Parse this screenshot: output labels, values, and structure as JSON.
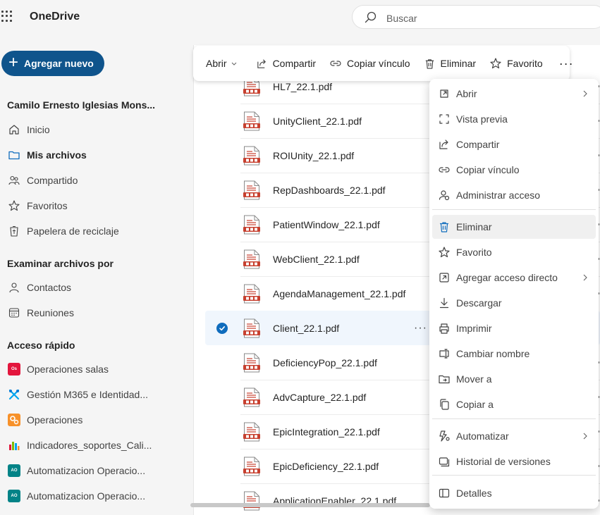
{
  "app": {
    "name": "OneDrive"
  },
  "search": {
    "placeholder": "Buscar"
  },
  "sidebar": {
    "add_new": "Agregar nuevo",
    "user": "Camilo Ernesto Iglesias Mons...",
    "nav": [
      {
        "label": "Inicio",
        "icon": "home-icon"
      },
      {
        "label": "Mis archivos",
        "icon": "folder-icon",
        "active": true
      },
      {
        "label": "Compartido",
        "icon": "people-icon"
      },
      {
        "label": "Favoritos",
        "icon": "star-icon"
      },
      {
        "label": "Papelera de reciclaje",
        "icon": "recycle-bin-icon"
      }
    ],
    "browse_title": "Examinar archivos por",
    "browse": [
      {
        "label": "Contactos",
        "icon": "person-icon"
      },
      {
        "label": "Reuniones",
        "icon": "calendar-icon"
      }
    ],
    "quick_title": "Acceso rápido",
    "quick": [
      {
        "label": "Operaciones salas",
        "badge": "Os",
        "color": "#e3163d"
      },
      {
        "label": "Gestión M365 e Identidad...",
        "badge": "x",
        "color": "#00a4ef"
      },
      {
        "label": "Operaciones",
        "badge": "",
        "color": "#f7912a"
      },
      {
        "label": "Indicadores_soportes_Cali...",
        "badge": "",
        "color": "#7fba00"
      },
      {
        "label": "Automatizacion Operacio...",
        "badge": "AO",
        "color": "#038387"
      },
      {
        "label": "Automatizacion Operacio...",
        "badge": "AO",
        "color": "#038387"
      }
    ]
  },
  "toolbar": {
    "open": "Abrir",
    "share": "Compartir",
    "copy_link": "Copiar vínculo",
    "delete": "Eliminar",
    "favorite": "Favorito",
    "more": "···"
  },
  "files": [
    {
      "name": "HL7_22.1.pdf"
    },
    {
      "name": "UnityClient_22.1.pdf"
    },
    {
      "name": "ROIUnity_22.1.pdf"
    },
    {
      "name": "RepDashboards_22.1.pdf"
    },
    {
      "name": "PatientWindow_22.1.pdf"
    },
    {
      "name": "WebClient_22.1.pdf"
    },
    {
      "name": "AgendaManagement_22.1.pdf"
    },
    {
      "name": "Client_22.1.pdf",
      "selected": true
    },
    {
      "name": "DeficiencyPop_22.1.pdf"
    },
    {
      "name": "AdvCapture_22.1.pdf"
    },
    {
      "name": "EpicIntegration_22.1.pdf"
    },
    {
      "name": "EpicDeficiency_22.1.pdf"
    },
    {
      "name": "ApplicationEnabler_22.1.pdf"
    }
  ],
  "row_more": "···",
  "context_menu": [
    {
      "label": "Abrir",
      "icon": "open-icon",
      "submenu": true
    },
    {
      "label": "Vista previa",
      "icon": "preview-icon"
    },
    {
      "label": "Compartir",
      "icon": "share-icon"
    },
    {
      "label": "Copiar vínculo",
      "icon": "link-icon"
    },
    {
      "label": "Administrar acceso",
      "icon": "manage-access-icon"
    },
    {
      "label": "Eliminar",
      "icon": "trash-icon",
      "hover": true
    },
    {
      "label": "Favorito",
      "icon": "star-icon"
    },
    {
      "label": "Agregar acceso directo",
      "icon": "shortcut-icon",
      "submenu": true
    },
    {
      "label": "Descargar",
      "icon": "download-icon"
    },
    {
      "label": "Imprimir",
      "icon": "print-icon"
    },
    {
      "label": "Cambiar nombre",
      "icon": "rename-icon"
    },
    {
      "label": "Mover a",
      "icon": "move-icon"
    },
    {
      "label": "Copiar a",
      "icon": "copy-icon"
    },
    {
      "label": "Automatizar",
      "icon": "automate-icon",
      "submenu": true
    },
    {
      "label": "Historial de versiones",
      "icon": "version-history-icon"
    },
    {
      "label": "Detalles",
      "icon": "details-icon"
    }
  ],
  "colors": {
    "accent": "#0f548c",
    "selected_row": "#f0f6fd",
    "check": "#0f6cbd",
    "pdf_red": "#c7402f"
  }
}
